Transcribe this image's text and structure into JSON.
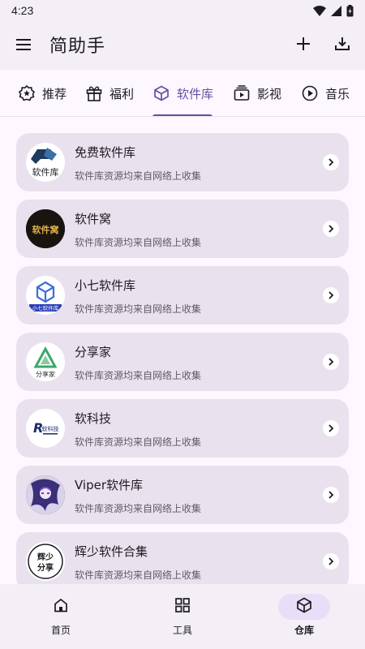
{
  "status_bar": {
    "time": "4:23"
  },
  "app_bar": {
    "title": "简助手"
  },
  "tabs": [
    {
      "label": "推荐",
      "icon": "star-badge-icon"
    },
    {
      "label": "福利",
      "icon": "gift-icon"
    },
    {
      "label": "软件库",
      "icon": "package-box-icon"
    },
    {
      "label": "影视",
      "icon": "video-playlist-icon"
    },
    {
      "label": "音乐",
      "icon": "play-circle-icon"
    }
  ],
  "active_tab": "软件库",
  "items": [
    {
      "title": "免费软件库",
      "desc": "软件库资源均来自网络上收集",
      "logo_text": "软件库"
    },
    {
      "title": "软件窝",
      "desc": "软件库资源均来自网络上收集",
      "logo_text": "软件窝"
    },
    {
      "title": "小七软件库",
      "desc": "软件库资源均来自网络上收集",
      "logo_text": "小七软件库"
    },
    {
      "title": "分享家",
      "desc": "软件库资源均来自网络上收集",
      "logo_text": "分享家"
    },
    {
      "title": "软科技",
      "desc": "软件库资源均来自网络上收集",
      "logo_text": "软科技"
    },
    {
      "title": "Viper软件库",
      "desc": "软件库资源均来自网络上收集",
      "logo_text": ""
    },
    {
      "title": "辉少软件合集",
      "desc": "软件库资源均来自网络上收集",
      "logo_text": "辉少分享"
    }
  ],
  "bottom_nav": [
    {
      "label": "首页",
      "icon": "home-icon"
    },
    {
      "label": "工具",
      "icon": "grid-icon"
    },
    {
      "label": "仓库",
      "icon": "package-box-icon"
    }
  ],
  "colors": {
    "accent": "#6750a4",
    "card_bg": "#e9e2ee",
    "surface": "#f4eef7",
    "background": "#fdf7ff",
    "active_nav_pill": "#e8def8"
  }
}
